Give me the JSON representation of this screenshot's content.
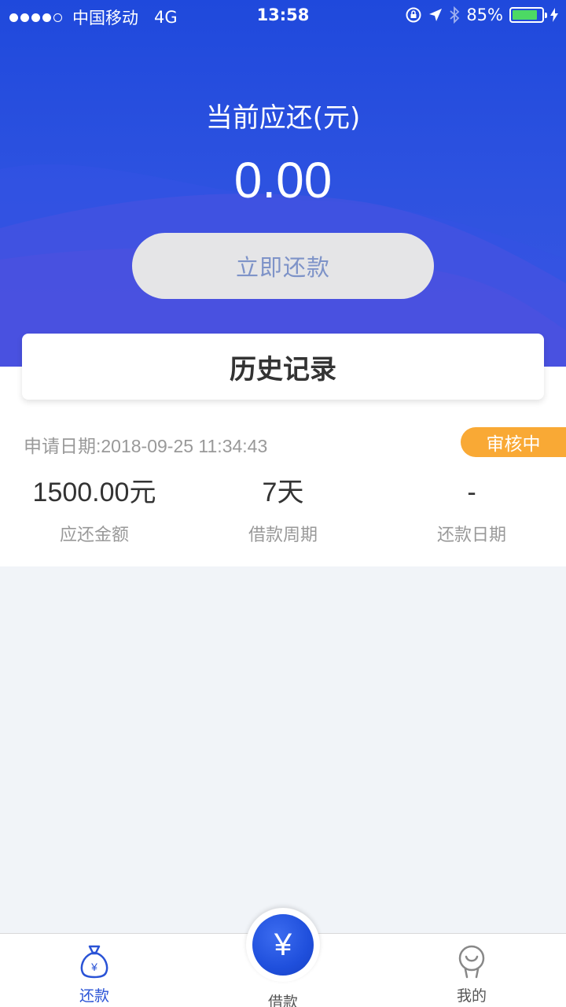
{
  "status_bar": {
    "carrier": "中国移动",
    "network": "4G",
    "time": "13:58",
    "battery_percent": "85%",
    "battery_level": 0.85
  },
  "repayment": {
    "due_label": "当前应还(元)",
    "due_amount": "0.00",
    "repay_button": "立即还款"
  },
  "history": {
    "title": "历史记录",
    "records": [
      {
        "apply_date": "申请日期:2018-09-25 11:34:43",
        "status": "审核中",
        "amount_value": "1500.00元",
        "amount_label": "应还金额",
        "period_value": "7天",
        "period_label": "借款周期",
        "repay_date_value": "-",
        "repay_date_label": "还款日期"
      }
    ]
  },
  "tabbar": {
    "items": [
      {
        "label": "还款",
        "icon": "money-bag-icon",
        "active": true
      },
      {
        "label": "借款",
        "icon": "yuan-icon",
        "active": false
      },
      {
        "label": "我的",
        "icon": "profile-icon",
        "active": false
      }
    ],
    "center_symbol": "¥"
  },
  "colors": {
    "primary": "#2a53d6",
    "badge": "#f9a935",
    "battery": "#4cd964"
  }
}
